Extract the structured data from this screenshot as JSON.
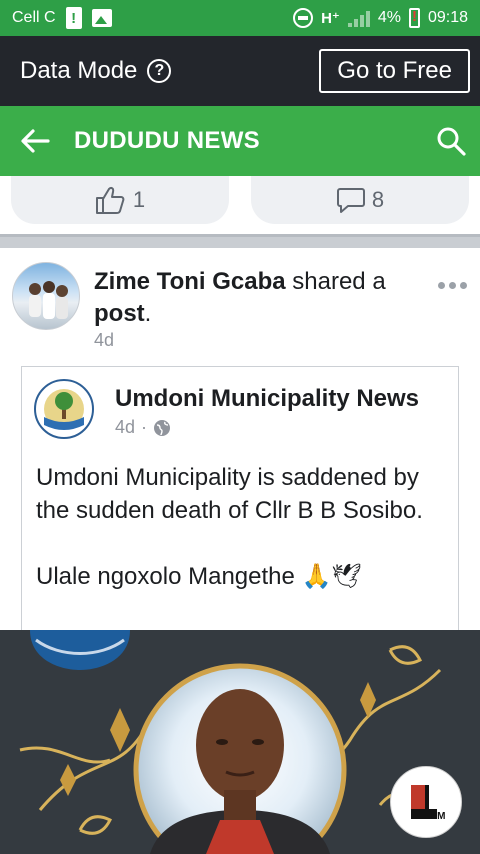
{
  "status_bar": {
    "carrier": "Cell C",
    "network": "H⁺",
    "battery": "4%",
    "time": "09:18",
    "icons": [
      "alert-box-icon",
      "gallery-icon",
      "data-saver-icon",
      "signal-icon",
      "battery-low-icon"
    ]
  },
  "data_mode": {
    "label": "Data Mode",
    "help": "?",
    "go_free_label": "Go to Free"
  },
  "header": {
    "title": "DUDUDU NEWS"
  },
  "reactions": {
    "likes": "1",
    "comments": "8"
  },
  "post": {
    "author": "Zime Toni Gcaba",
    "action": " shared a ",
    "object": "post",
    "punct": ".",
    "time": "4d",
    "shared": {
      "page_name": "Umdoni Municipality News",
      "time": "4d",
      "separator": "·",
      "text_1": "Umdoni Municipality is saddened by the sudden death of Cllr B B Sosibo.",
      "text_2": "Ulale ngoxolo Mangethe 🙏🕊"
    }
  },
  "colors": {
    "status_green": "#2e9f47",
    "header_green": "#3bae4a",
    "data_bar": "#23262c"
  }
}
